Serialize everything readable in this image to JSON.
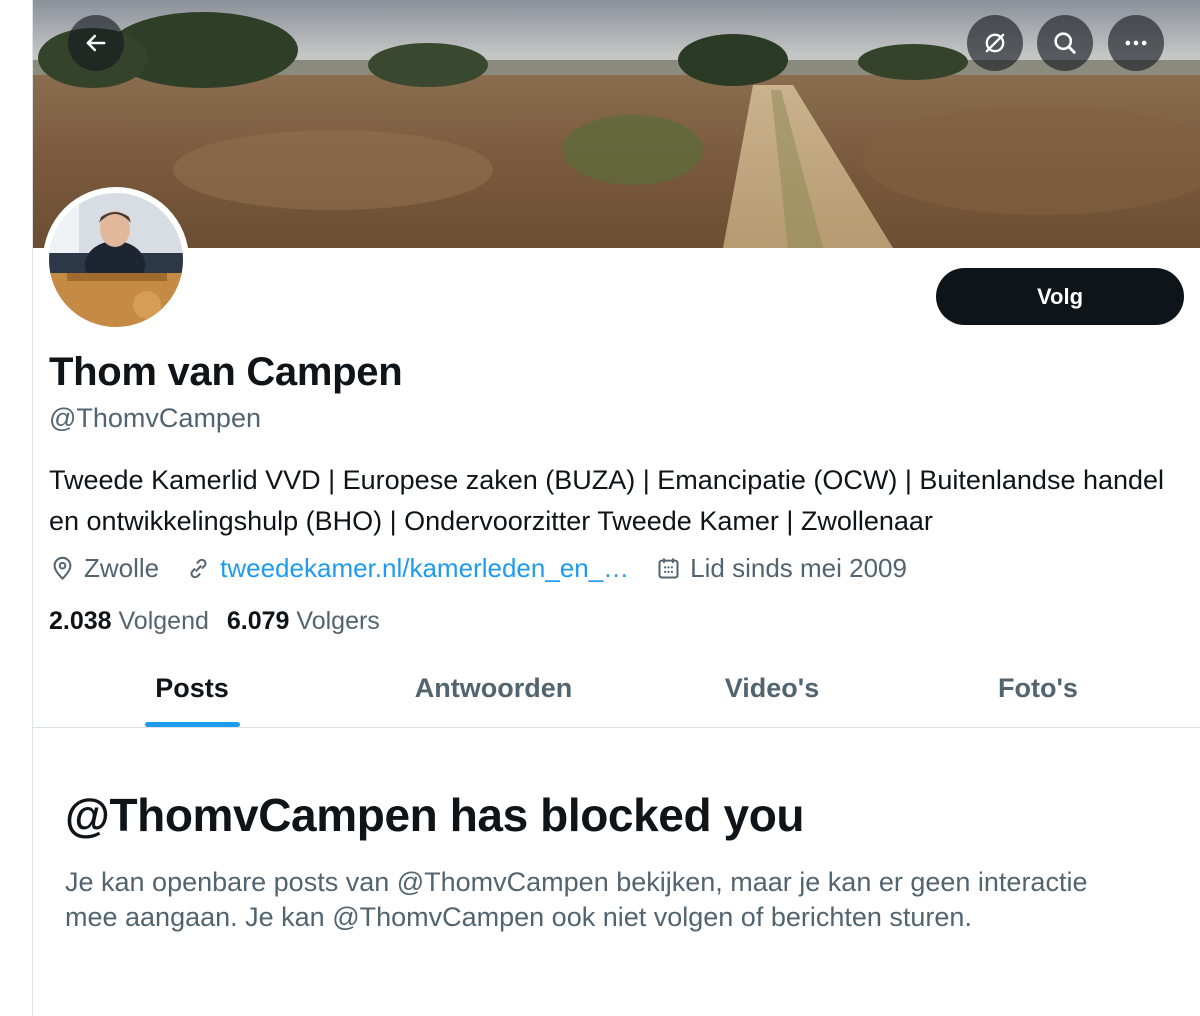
{
  "header": {
    "back_icon": "arrow-left-icon",
    "grok_icon": "slashed-circle-icon",
    "search_icon": "search-icon",
    "more_icon": "more-dots-icon"
  },
  "profile": {
    "name": "Thom van Campen",
    "handle": "@ThomvCampen",
    "follow_label": "Volg",
    "bio": "Tweede Kamerlid VVD | Europese zaken (BUZA) | Emancipatie (OCW) | Buitenlandse handel en ontwikkelingshulp (BHO) | Ondervoorzitter Tweede Kamer | Zwollenaar",
    "location": "Zwolle",
    "website": "tweedekamer.nl/kamerleden_en_…",
    "joined": "Lid sinds mei 2009",
    "following_count": "2.038",
    "following_label": "Volgend",
    "followers_count": "6.079",
    "followers_label": "Volgers"
  },
  "tabs": [
    {
      "label": "Posts",
      "active": true
    },
    {
      "label": "Antwoorden",
      "active": false
    },
    {
      "label": "Video's",
      "active": false
    },
    {
      "label": "Foto's",
      "active": false
    }
  ],
  "blocked": {
    "title": "@ThomvCampen has blocked you",
    "message": "Je kan openbare posts van @ThomvCampen bekijken, maar je kan er geen interactie mee aangaan. Je kan @ThomvCampen ook niet volgen of berichten sturen."
  },
  "colors": {
    "accent": "#1d9bf0",
    "text": "#0f1419",
    "secondary": "#536471",
    "button": "#0f1419"
  }
}
